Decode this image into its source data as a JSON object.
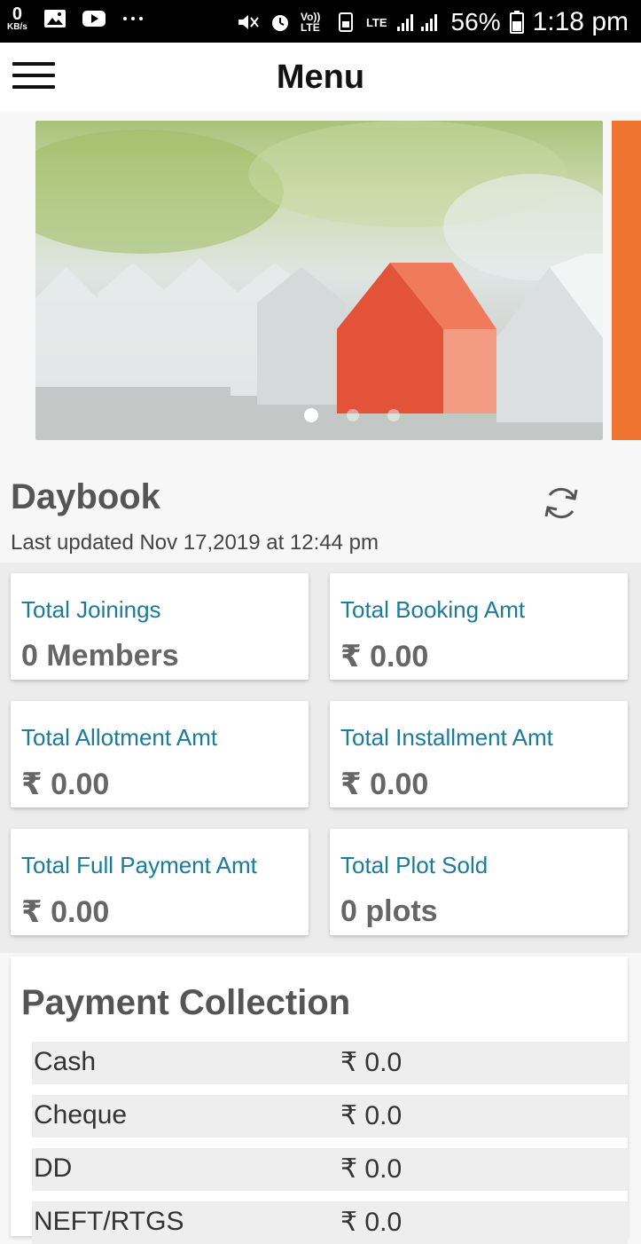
{
  "status_bar": {
    "speed_value": "0",
    "speed_unit": "KB/s",
    "volte_label": "Vo)) LTE",
    "lte_label": "LTE",
    "battery_percent": "56%",
    "time": "1:18 pm",
    "icons": [
      "image-icon",
      "youtube-icon",
      "more-icon",
      "mute-icon",
      "alarm-icon",
      "sim-icon",
      "signal-icon",
      "battery-icon"
    ]
  },
  "app_bar": {
    "title": "Menu",
    "menu_icon": "hamburger-icon"
  },
  "carousel": {
    "slides": 3,
    "active_index": 0,
    "accent": "#ee742f"
  },
  "daybook": {
    "title": "Daybook",
    "last_updated": "Last updated Nov 17,2019 at 12:44 pm",
    "refresh_icon": "refresh-icon"
  },
  "cards": [
    {
      "label": "Total Joinings",
      "value": "0 Members"
    },
    {
      "label": "Total Booking Amt",
      "value": "₹ 0.00"
    },
    {
      "label": "Total Allotment Amt",
      "value": "₹ 0.00"
    },
    {
      "label": "Total Installment Amt",
      "value": "₹ 0.00"
    },
    {
      "label": "Total Full Payment Amt",
      "value": "₹ 0.00"
    },
    {
      "label": "Total Plot Sold",
      "value": "0 plots"
    }
  ],
  "payment_collection": {
    "title": "Payment Collection",
    "rows": [
      {
        "name": "Cash",
        "amount": "₹ 0.0"
      },
      {
        "name": "Cheque",
        "amount": "₹ 0.0"
      },
      {
        "name": "DD",
        "amount": "₹ 0.0"
      },
      {
        "name": "NEFT/RTGS",
        "amount": "₹ 0.0"
      }
    ]
  },
  "colors": {
    "label_blue": "#1a7b9a",
    "value_gray": "#666666",
    "background": "#f7f7f7"
  }
}
